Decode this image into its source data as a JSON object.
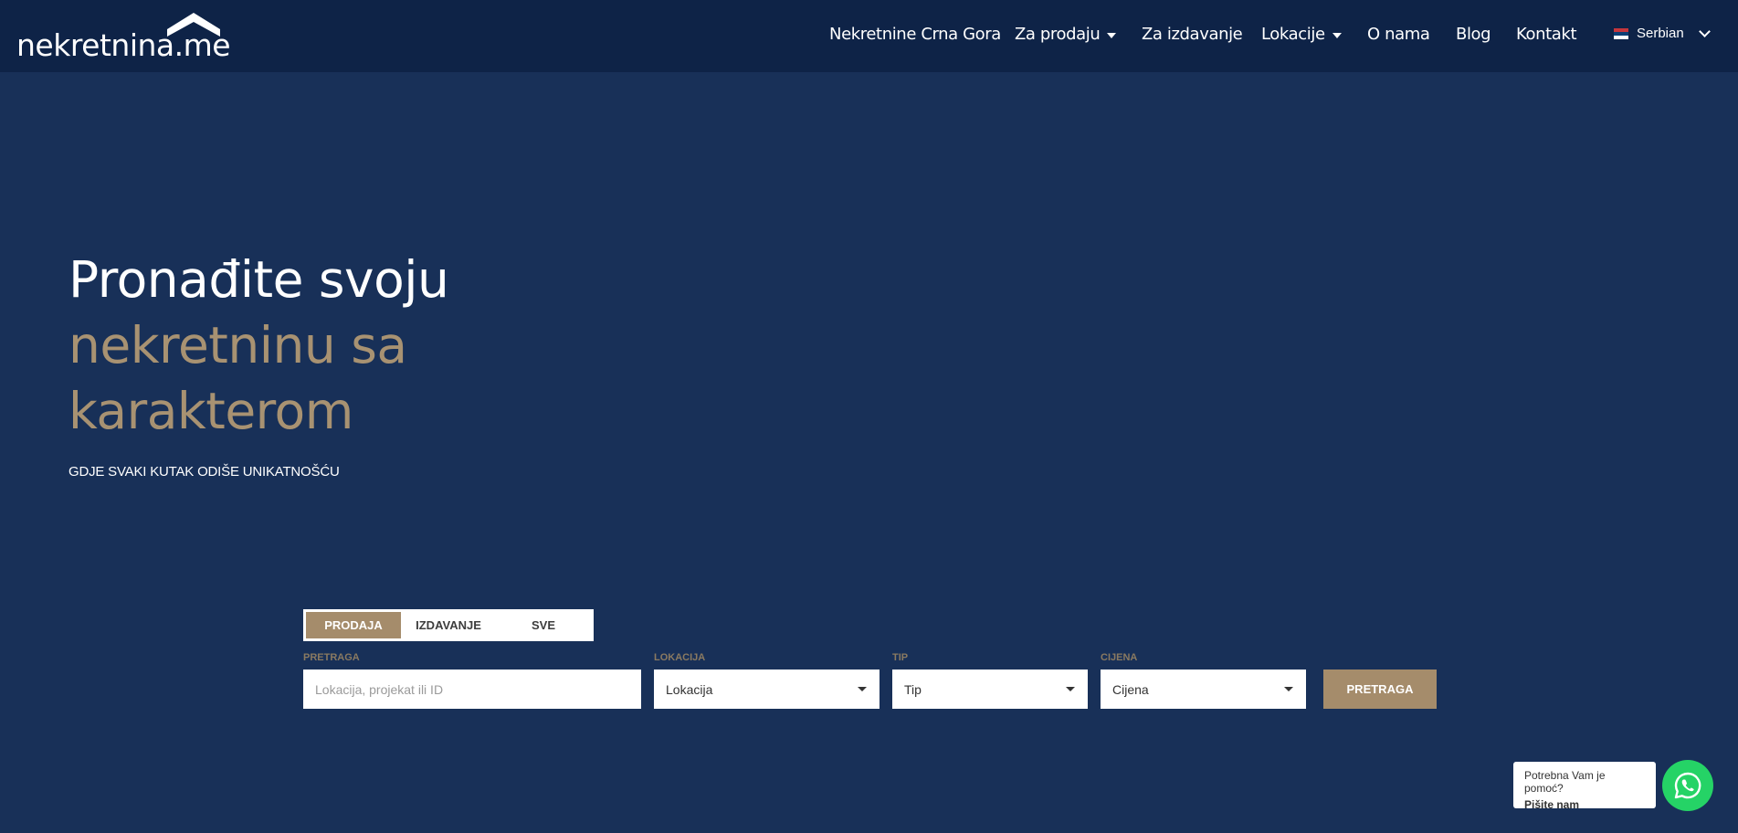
{
  "logo": {
    "name": "nekretnina",
    "domain": ".me"
  },
  "nav": [
    {
      "label": "Nekretnine Crna Gora",
      "dropdown": false
    },
    {
      "label": "Za prodaju",
      "dropdown": true
    },
    {
      "label": "Za izdavanje",
      "dropdown": false
    },
    {
      "label": "Lokacije",
      "dropdown": true
    },
    {
      "label": "O nama",
      "dropdown": false
    },
    {
      "label": "Blog",
      "dropdown": false
    },
    {
      "label": "Kontakt",
      "dropdown": false
    }
  ],
  "language": {
    "label": "Serbian",
    "icon": "serbia-flag-icon"
  },
  "hero": {
    "line1": "Pronađite svoju",
    "line2": "nekretninu sa",
    "line3": "karakterom",
    "subtitle": "GDJE SVAKI KUTAK ODIŠE UNIKATNOŠĆU"
  },
  "search": {
    "tabs": [
      "PRODAJA",
      "IZDAVANJE",
      "SVE"
    ],
    "active_tab": "PRODAJA",
    "fields": {
      "query": {
        "label": "PRETRAGA",
        "placeholder": "Lokacija, projekat ili ID",
        "value": ""
      },
      "location": {
        "label": "LOKACIJA",
        "value": "Lokacija"
      },
      "type": {
        "label": "TIP",
        "value": "Tip"
      },
      "price": {
        "label": "CIJENA",
        "value": "Cijena"
      }
    },
    "button": "PRETRAGA"
  },
  "help": {
    "line1": "Potrebna Vam je pomoć?",
    "line2": "Pišite nam",
    "icon": "whatsapp-icon"
  },
  "colors": {
    "background": "#183058",
    "header": "#0e2347",
    "accent": "#a58c6b",
    "whatsapp": "#25d366"
  }
}
